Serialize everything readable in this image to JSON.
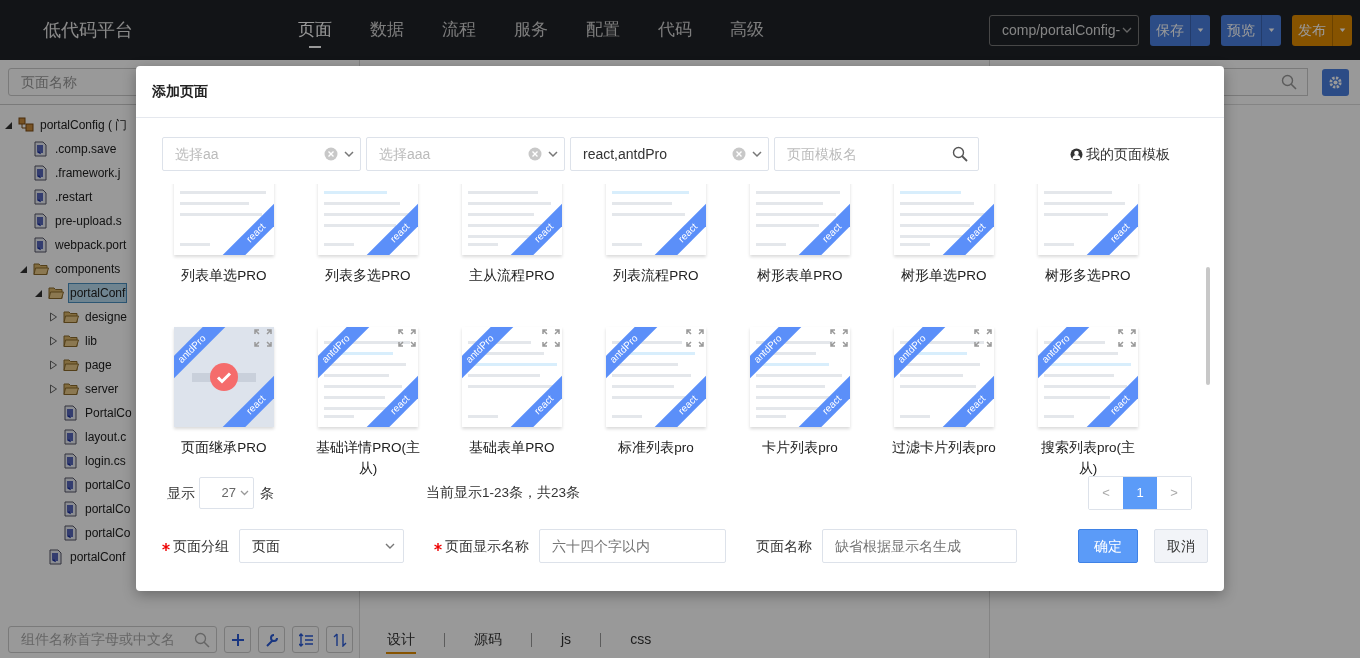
{
  "app": {
    "title": "低代码平台"
  },
  "nav": [
    {
      "label": "页面",
      "selected": true
    },
    {
      "label": "数据",
      "selected": false
    },
    {
      "label": "流程",
      "selected": false
    },
    {
      "label": "服务",
      "selected": false
    },
    {
      "label": "配置",
      "selected": false
    },
    {
      "label": "代码",
      "selected": false
    },
    {
      "label": "高级",
      "selected": false
    }
  ],
  "project_select": {
    "value": "comp/portalConfig-"
  },
  "actions": [
    {
      "label": "保存",
      "kind": "primary"
    },
    {
      "label": "预览",
      "kind": "primary"
    },
    {
      "label": "发布",
      "kind": "warning"
    }
  ],
  "sidebar": {
    "search": {
      "placeholder": "页面名称"
    },
    "tree": [
      {
        "label": "portalConfig ( 门",
        "kind": "project",
        "expanded": true,
        "selected": false,
        "children": [
          {
            "label": ".comp.save",
            "kind": "file",
            "selected": false
          },
          {
            "label": ".framework.j",
            "kind": "file",
            "selected": false
          },
          {
            "label": ".restart",
            "kind": "file",
            "selected": false
          },
          {
            "label": "pre-upload.s",
            "kind": "file",
            "selected": false
          },
          {
            "label": "webpack.port",
            "kind": "file",
            "selected": false
          },
          {
            "label": "components",
            "kind": "folder",
            "expanded": true,
            "selected": false,
            "children": [
              {
                "label": "portalConf",
                "kind": "folder",
                "expanded": true,
                "selected": true,
                "children": [
                  {
                    "label": "designe",
                    "kind": "folder",
                    "expanded": false,
                    "selected": false
                  },
                  {
                    "label": "lib",
                    "kind": "folder",
                    "expanded": false,
                    "selected": false
                  },
                  {
                    "label": "page",
                    "kind": "folder",
                    "expanded": false,
                    "selected": false
                  },
                  {
                    "label": "server",
                    "kind": "folder",
                    "expanded": false,
                    "selected": false
                  },
                  {
                    "label": "PortalCo",
                    "kind": "file",
                    "selected": false
                  },
                  {
                    "label": "layout.c",
                    "kind": "file",
                    "selected": false
                  },
                  {
                    "label": "login.cs",
                    "kind": "file",
                    "selected": false
                  },
                  {
                    "label": "portalCo",
                    "kind": "file",
                    "selected": false
                  },
                  {
                    "label": "portalCo",
                    "kind": "file",
                    "selected": false
                  },
                  {
                    "label": "portalCo",
                    "kind": "file",
                    "selected": false
                  }
                ]
              },
              {
                "label": "portalConf",
                "kind": "file",
                "selected": false
              }
            ]
          }
        ]
      }
    ],
    "component_search": {
      "placeholder": "组件名称首字母或中文名"
    },
    "tools": [
      {
        "kind": "add"
      },
      {
        "kind": "wrench"
      },
      {
        "kind": "order"
      },
      {
        "kind": "sort"
      }
    ]
  },
  "editor_tabs": [
    {
      "label": "设计",
      "selected": true
    },
    {
      "label": "源码",
      "selected": false
    },
    {
      "label": "js",
      "selected": false
    },
    {
      "label": "css",
      "selected": false
    }
  ],
  "dialog": {
    "title": "添加页面",
    "filters": [
      {
        "kind": "select",
        "placeholder": "选择aa"
      },
      {
        "kind": "select",
        "placeholder": "选择aaa"
      },
      {
        "kind": "select",
        "value": "react,antdPro"
      },
      {
        "kind": "search",
        "placeholder": "页面模板名"
      }
    ],
    "my_templates": "我的页面模板",
    "templates": [
      {
        "name": "列表单选PRO",
        "tags": [
          "react"
        ],
        "expandable": false,
        "selected": false
      },
      {
        "name": "列表多选PRO",
        "tags": [
          "react"
        ],
        "expandable": false,
        "selected": false
      },
      {
        "name": "主从流程PRO",
        "tags": [
          "react"
        ],
        "expandable": false,
        "selected": false
      },
      {
        "name": "列表流程PRO",
        "tags": [
          "react"
        ],
        "expandable": false,
        "selected": false
      },
      {
        "name": "树形表单PRO",
        "tags": [
          "react"
        ],
        "expandable": false,
        "selected": false
      },
      {
        "name": "树形单选PRO",
        "tags": [
          "react"
        ],
        "expandable": false,
        "selected": false
      },
      {
        "name": "树形多选PRO",
        "tags": [
          "react"
        ],
        "expandable": false,
        "selected": false
      },
      {
        "name": "页面继承PRO",
        "tags": [
          "antdPro",
          "react"
        ],
        "expandable": true,
        "selected": true
      },
      {
        "name": "基础详情PRO(主从)",
        "tags": [
          "antdPro",
          "react"
        ],
        "expandable": true,
        "selected": false
      },
      {
        "name": "基础表单PRO",
        "tags": [
          "antdPro",
          "react"
        ],
        "expandable": true,
        "selected": false
      },
      {
        "name": "标准列表pro",
        "tags": [
          "antdPro",
          "react"
        ],
        "expandable": true,
        "selected": false
      },
      {
        "name": "卡片列表pro",
        "tags": [
          "antdPro",
          "react"
        ],
        "expandable": true,
        "selected": false
      },
      {
        "name": "过滤卡片列表pro",
        "tags": [
          "antdPro",
          "react"
        ],
        "expandable": true,
        "selected": false
      },
      {
        "name": "搜索列表pro(主从)",
        "tags": [
          "antdPro",
          "react"
        ],
        "expandable": true,
        "selected": false
      }
    ],
    "page_size": {
      "label_before": "显示",
      "value": "27",
      "label_after": "条"
    },
    "summary": "当前显示1-23条，共23条",
    "pagination": {
      "prev": "<",
      "next": ">",
      "pages": [
        {
          "label": "1",
          "selected": true
        }
      ]
    },
    "form": [
      {
        "label": "页面分组",
        "required": true,
        "kind": "select",
        "value": "页面"
      },
      {
        "label": "页面显示名称",
        "required": true,
        "kind": "input",
        "placeholder": "六十四个字以内"
      },
      {
        "label": "页面名称",
        "required": false,
        "kind": "input",
        "placeholder": "缺省根据显示名生成"
      }
    ],
    "buttons": [
      {
        "label": "确定",
        "kind": "primary"
      },
      {
        "label": "取消",
        "kind": "secondary"
      }
    ]
  }
}
